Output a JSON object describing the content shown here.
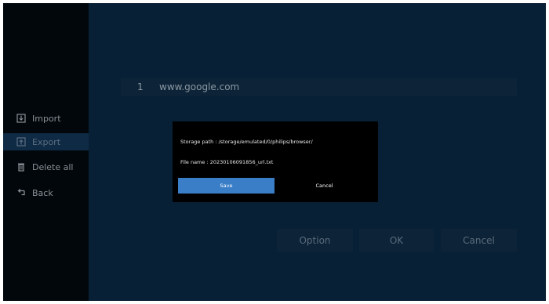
{
  "sidebar": {
    "items": [
      {
        "label": "Import",
        "icon": "import-icon",
        "selected": false
      },
      {
        "label": "Export",
        "icon": "export-icon",
        "selected": true
      },
      {
        "label": "Delete all",
        "icon": "trash-icon",
        "selected": false
      },
      {
        "label": "Back",
        "icon": "back-arrow-icon",
        "selected": false
      }
    ]
  },
  "url_list": {
    "items": [
      {
        "index": "1",
        "url": "www.google.com"
      }
    ]
  },
  "buttons": {
    "option": "Option",
    "ok": "OK",
    "cancel": "Cancel"
  },
  "dialog": {
    "storage_path": "Storage path : /storage/emulated/0/philips/browser/",
    "file_name": "File name : 20230106091856_url.txt",
    "save_label": "Save",
    "cancel_label": "Cancel"
  },
  "colors": {
    "background": "#082035",
    "sidebar": "#02070c",
    "accent": "#3a7ec8"
  }
}
